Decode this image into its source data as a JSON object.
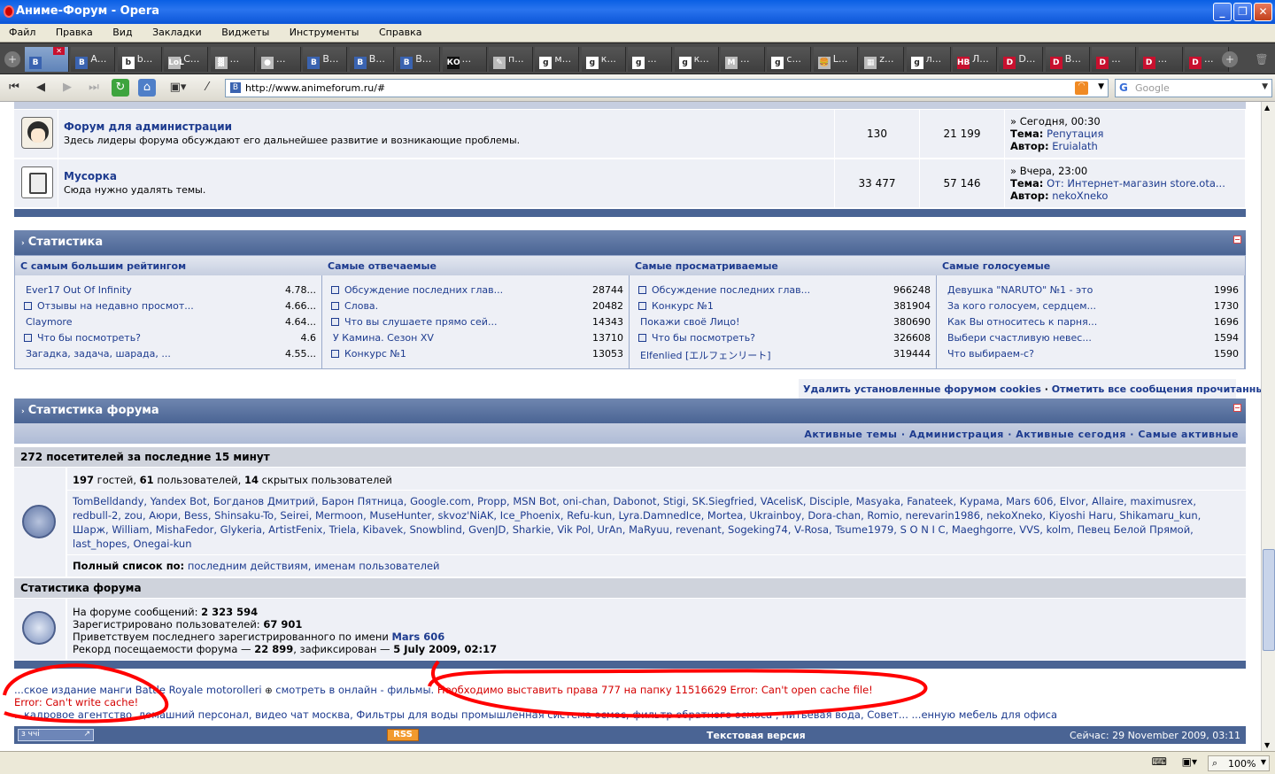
{
  "window": {
    "title": "Аниме-Форум - Opera"
  },
  "menu": [
    "Файл",
    "Правка",
    "Вид",
    "Закладки",
    "Виджеты",
    "Инструменты",
    "Справка"
  ],
  "tabs": [
    {
      "icon": "В",
      "label": "",
      "active": true
    },
    {
      "icon": "В",
      "label": "А..."
    },
    {
      "icon": "b",
      "label": "b..."
    },
    {
      "icon": "LoL",
      "label": "С..."
    },
    {
      "icon": "▓",
      "label": "..."
    },
    {
      "icon": "●",
      "label": "..."
    },
    {
      "icon": "В",
      "label": "В..."
    },
    {
      "icon": "В",
      "label": "В..."
    },
    {
      "icon": "В",
      "label": "В..."
    },
    {
      "icon": "КО",
      "label": "..."
    },
    {
      "icon": "✎",
      "label": "п..."
    },
    {
      "icon": "g",
      "label": "м..."
    },
    {
      "icon": "g",
      "label": "к..."
    },
    {
      "icon": "g",
      "label": "..."
    },
    {
      "icon": "g",
      "label": "к..."
    },
    {
      "icon": "M",
      "label": "..."
    },
    {
      "icon": "g",
      "label": "с..."
    },
    {
      "icon": "🍔",
      "label": "L..."
    },
    {
      "icon": "▦",
      "label": "z..."
    },
    {
      "icon": "g",
      "label": "л..."
    },
    {
      "icon": "HB",
      "label": "Л..."
    },
    {
      "icon": "D",
      "label": "D..."
    },
    {
      "icon": "D",
      "label": "В..."
    },
    {
      "icon": "D",
      "label": "..."
    },
    {
      "icon": "D",
      "label": "..."
    },
    {
      "icon": "D",
      "label": "..."
    }
  ],
  "address": {
    "url": "http://www.animeforum.ru/#",
    "search_placeholder": "Google"
  },
  "forums": [
    {
      "title": "Форум для администрации",
      "desc": "Здесь лидеры форума обсуждают его дальнейшее развитие и возникающие проблемы.",
      "topics": "130",
      "posts": "21 199",
      "last_when": "» Сегодня, 00:30",
      "last_topic_label": "Тема:",
      "last_topic": "Репутация",
      "last_author_label": "Автор:",
      "last_author": "Eruialath"
    },
    {
      "title": "Мусорка",
      "desc": "Сюда нужно удалять темы.",
      "topics": "33 477",
      "posts": "57 146",
      "last_when": "» Вчера, 23:00",
      "last_topic_label": "Тема:",
      "last_topic": "От: Интернет-магазин store.ota...",
      "last_author_label": "Автор:",
      "last_author": "nekoXneko"
    }
  ],
  "stats": {
    "title": "Статистика",
    "columns": [
      {
        "header": "С самым большим рейтингом",
        "items": [
          {
            "name": "Ever17 Out Of Infinity",
            "value": "4.78...",
            "cb": false
          },
          {
            "name": "Отзывы на недавно просмот...",
            "value": "4.66...",
            "cb": true
          },
          {
            "name": "Claymore",
            "value": "4.64...",
            "cb": false
          },
          {
            "name": "Что бы посмотреть?",
            "value": "4.6",
            "cb": true
          },
          {
            "name": "Загадка, задача, шарада, ...",
            "value": "4.55...",
            "cb": false
          }
        ]
      },
      {
        "header": "Самые отвечаемые",
        "items": [
          {
            "name": "Обсуждение последних глав...",
            "value": "28744",
            "cb": true
          },
          {
            "name": "Слова.",
            "value": "20482",
            "cb": true
          },
          {
            "name": "Что вы слушаете прямо сей...",
            "value": "14343",
            "cb": true
          },
          {
            "name": "У Камина. Сезон XV",
            "value": "13710",
            "cb": false
          },
          {
            "name": "Конкурс №1",
            "value": "13053",
            "cb": true
          }
        ]
      },
      {
        "header": "Самые просматриваемые",
        "items": [
          {
            "name": "Обсуждение последних глав...",
            "value": "966248",
            "cb": true
          },
          {
            "name": "Конкурс №1",
            "value": "381904",
            "cb": true
          },
          {
            "name": "Покажи своё Лицо!",
            "value": "380690",
            "cb": false
          },
          {
            "name": "Что бы посмотреть?",
            "value": "326608",
            "cb": true
          },
          {
            "name": "Elfenlied [エルフェンリート]",
            "value": "319444",
            "cb": false
          }
        ]
      },
      {
        "header": "Самые голосуемые",
        "items": [
          {
            "name": "Девушка \"NARUTO\" №1 - это",
            "value": "1996",
            "cb": false
          },
          {
            "name": "За кого голосуем, сердцем...",
            "value": "1730",
            "cb": false
          },
          {
            "name": "Как Вы относитесь к парня...",
            "value": "1696",
            "cb": false
          },
          {
            "name": "Выбери счастливую невес...",
            "value": "1594",
            "cb": false
          },
          {
            "name": "Что выбираем-с?",
            "value": "1590",
            "cb": false
          }
        ]
      }
    ]
  },
  "cookie_links": {
    "delete": "Удалить установленные форумом cookies",
    "sep": "·",
    "mark": "Отметить все сообщения прочитанными"
  },
  "forum_stats": {
    "title": "Статистика форума",
    "links": [
      "Активные темы",
      "Администрация",
      "Активные сегодня",
      "Самые активные"
    ],
    "link_sep": "·",
    "visitors_header": "272 посетителей за последние 15 минут",
    "guests_num": "197",
    "guests_text": "гостей,",
    "users_num": "61",
    "users_text": "пользователей,",
    "hidden_num": "14",
    "hidden_text": "скрытых пользователей",
    "users_list_1": "TomBelldandy, Yandex Bot, Богданов Дмитрий, Барон Пятница, Google.com, Propp, MSN Bot, oni-chan, Dabonot, Stigi, SK.Siegfried, VAcelisK, Disciple, Masyaka, Fanateek, Курама, Mars 606, Elvor, Allaire, maximusrex,",
    "users_list_2": "redbull-2, zou, Аюри, Bess, Shinsaku-To, Seirei, Mermoon, MuseHunter, skvoz'NiAK, Ice_Phoenix, Refu-kun, Lyra.DamnedIce, Mortea, Ukrainboy, Dora-chan, Romio, nerevarin1986, nekoXneko, Kiyoshi Haru, Shikamaru_kun,",
    "users_list_3": "Шарж, William, MishaFedor, Glykeria, ArtistFenix, Triela, Kibavek, Snowblind, GvenJD, Sharkie, Vik Pol, UrAn, MaRyuu, revenant, Sogeking74, V-Rosa, Tsume1979, S O N I C, Maeghgorre, VVS, kolm, Певец Белой Прямой,",
    "users_list_4": "last_hopes, Onegai-kun",
    "full_list_label": "Полный список по:",
    "full_list_links": "последним действиям, именам пользователей",
    "stats_header": "Статистика форума",
    "msgs_label": "На форуме сообщений:",
    "msgs": "2 323 594",
    "reg_label": "Зарегистрировано пользователей:",
    "reg": "67 901",
    "newest_label": "Приветствуем последнего зарегистрированного по имени",
    "newest": "Mars 606",
    "record_label": "Рекорд посещаемости форума —",
    "record": "22 899",
    "record_mid": ", зафиксирован —",
    "record_date": "5 July 2009, 02:17"
  },
  "footer": {
    "line1_a": "...ское издание манги Battle Royale motorolleri",
    "line1_b": "смотреть в онлайн - фильмы.",
    "line1_err": "Необходимо выставить права 777 на папку 11516629 Error: Can't open cache file!",
    "line2_err": "Error: Can't write cache!",
    "line3": "...кадровое агентство, домашний персонал, видео чат москва, Фильтры для воды промышленная система осмос, фильтр обратного осмоса , питьевая вода, Совет... ...енную мебель для офиса",
    "lang": "з ччі",
    "rss": "RSS",
    "text_version": "Текстовая версия",
    "now": "Сейчас: 29 November 2009, 03:11"
  },
  "statusbar": {
    "zoom": "100%"
  },
  "colors": {
    "category_bar": "#4a6494",
    "error_red": "#d40000",
    "link": "#1d3b8f",
    "annotation": "#ff0000"
  }
}
